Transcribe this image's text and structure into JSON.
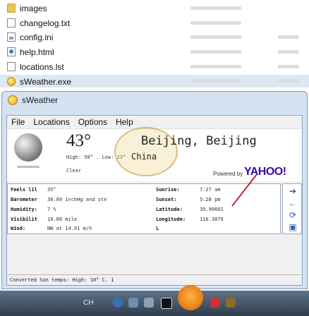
{
  "explorer": {
    "files": [
      {
        "name": "images",
        "icon": "folder-icon"
      },
      {
        "name": "changelog.txt",
        "icon": "text-file-icon"
      },
      {
        "name": "config.ini",
        "icon": "config-file-icon"
      },
      {
        "name": "help.html",
        "icon": "html-file-icon"
      },
      {
        "name": "locations.lst",
        "icon": "list-file-icon"
      },
      {
        "name": "sWeather.exe",
        "icon": "app-icon"
      }
    ]
  },
  "window": {
    "title": "sWeather",
    "menu": [
      "File",
      "Locations",
      "Options",
      "Help"
    ]
  },
  "weather": {
    "temperature": "43°",
    "hilo": "High: 50° . Low: 23°",
    "condition": "Clear",
    "city": "Beijing, Beijing",
    "country": "China",
    "powered_by": "Powered by",
    "provider": "YAHOO!",
    "icon": "moon-icon"
  },
  "details": {
    "left": [
      {
        "label": "Feels lil",
        "value": "35°"
      },
      {
        "label": "Barometer",
        "value": "30.09 inchHg and ste"
      },
      {
        "label": "Humidity:",
        "value": "7 %"
      },
      {
        "label": "Visibilit",
        "value": "10.00 mile"
      },
      {
        "label": "Wind:",
        "value": "NW at 14.91 m/h"
      }
    ],
    "right": [
      {
        "label": "Sunrise:",
        "value": "7:27 am"
      },
      {
        "label": "Sunset:",
        "value": "5:28 pm"
      },
      {
        "label": "Latitude:",
        "value": "39.90601"
      },
      {
        "label": "Longitude:",
        "value": "116.3876"
      },
      {
        "label": "L",
        "value": ""
      }
    ]
  },
  "side_buttons": [
    "arrow-right-icon",
    "arrow-left-icon",
    "refresh-icon",
    "window-icon"
  ],
  "status": "Converted Sun temps: High: 10° C.  1",
  "taskbar": {
    "lang": "CH",
    "colors": {
      "taskbar_top": "#5e7387",
      "taskbar_bottom": "#2f3d4e",
      "yahoo_purple": "#3a0aa0"
    }
  }
}
